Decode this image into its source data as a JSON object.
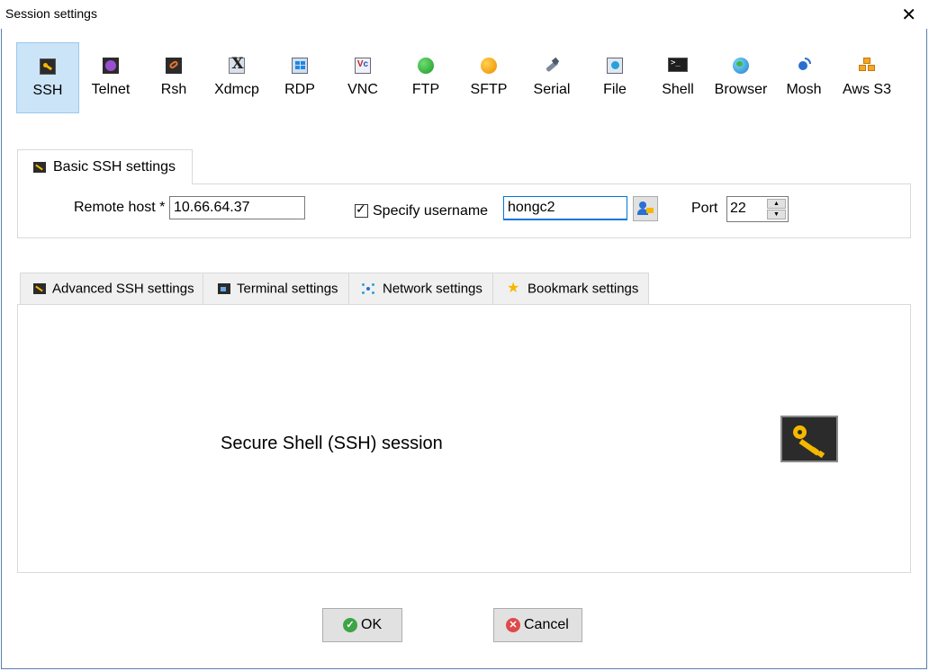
{
  "window": {
    "title": "Session settings"
  },
  "session_types": [
    {
      "label": "SSH",
      "icon": "ssh-key-icon",
      "selected": true
    },
    {
      "label": "Telnet",
      "icon": "telnet-icon"
    },
    {
      "label": "Rsh",
      "icon": "rsh-icon"
    },
    {
      "label": "Xdmcp",
      "icon": "xdmcp-icon"
    },
    {
      "label": "RDP",
      "icon": "rdp-icon"
    },
    {
      "label": "VNC",
      "icon": "vnc-icon"
    },
    {
      "label": "FTP",
      "icon": "ftp-globe-icon"
    },
    {
      "label": "SFTP",
      "icon": "sftp-globe-icon"
    },
    {
      "label": "Serial",
      "icon": "serial-plug-icon"
    },
    {
      "label": "File",
      "icon": "file-monitor-icon"
    },
    {
      "label": "Shell",
      "icon": "shell-terminal-icon"
    },
    {
      "label": "Browser",
      "icon": "browser-globe-icon"
    },
    {
      "label": "Mosh",
      "icon": "mosh-antenna-icon"
    },
    {
      "label": "Aws S3",
      "icon": "aws-s3-cubes-icon"
    }
  ],
  "basic": {
    "tab_label": "Basic SSH settings",
    "remote_host_label": "Remote host *",
    "remote_host_value": "10.66.64.37",
    "specify_username_label": "Specify username",
    "specify_username_checked": true,
    "username_value": "hongc2",
    "port_label": "Port",
    "port_value": "22"
  },
  "sub_tabs": [
    {
      "label": "Advanced SSH settings",
      "icon": "ssh-key-icon"
    },
    {
      "label": "Terminal settings",
      "icon": "terminal-icon"
    },
    {
      "label": "Network settings",
      "icon": "network-icon"
    },
    {
      "label": "Bookmark settings",
      "icon": "star-icon"
    }
  ],
  "content": {
    "session_description": "Secure Shell (SSH) session"
  },
  "buttons": {
    "ok": "OK",
    "cancel": "Cancel"
  },
  "colors": {
    "selection_bg": "#cce4f7",
    "focus_border": "#0078d7",
    "ok_green": "#3ca545",
    "cancel_red": "#e04a4a",
    "key_gold": "#f5b800"
  }
}
